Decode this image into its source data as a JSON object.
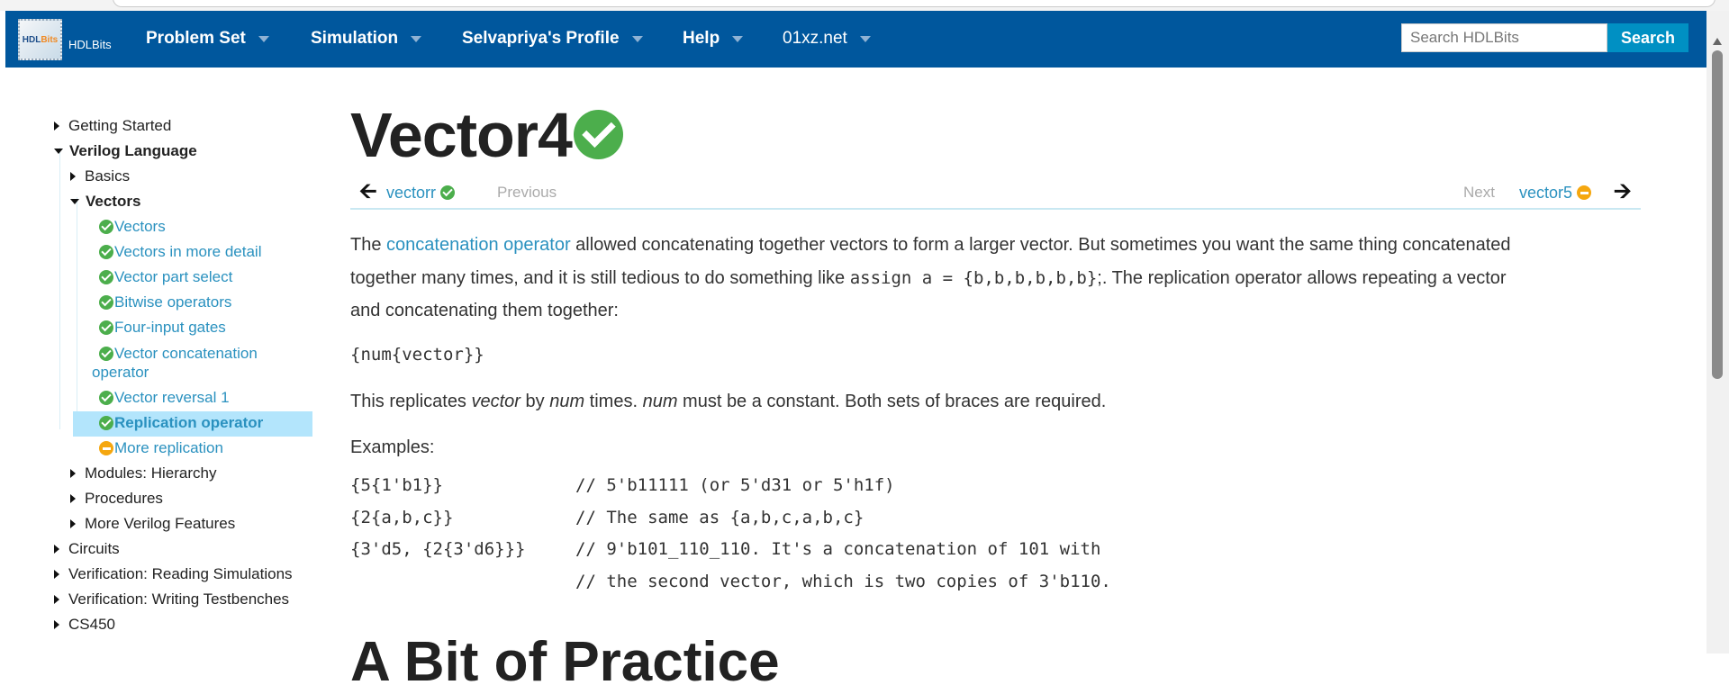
{
  "navbar": {
    "logo_text_a": "HDL",
    "logo_text_b": "Bits",
    "brand": "HDLBits",
    "menus": [
      {
        "label": "Problem Set"
      },
      {
        "label": "Simulation"
      },
      {
        "label": "Selvapriya's Profile"
      },
      {
        "label": "Help"
      },
      {
        "label": "01xz.net"
      }
    ],
    "search_placeholder": "Search HDLBits",
    "search_button": "Search",
    "color": "#00579d"
  },
  "sidebar": {
    "items": [
      {
        "label": "Getting Started"
      },
      {
        "label": "Verilog Language"
      },
      {
        "label": "Basics"
      },
      {
        "label": "Vectors"
      },
      {
        "label": "Vectors",
        "status": "done"
      },
      {
        "label": "Vectors in more detail",
        "status": "done"
      },
      {
        "label": "Vector part select",
        "status": "done"
      },
      {
        "label": "Bitwise operators",
        "status": "done"
      },
      {
        "label": "Four-input gates",
        "status": "done"
      },
      {
        "label": "Vector concatenation",
        "label2": "operator",
        "status": "done"
      },
      {
        "label": "Vector reversal 1",
        "status": "done"
      },
      {
        "label": "Replication operator",
        "status": "done",
        "active": true
      },
      {
        "label": "More replication",
        "status": "pending"
      },
      {
        "label": "Modules: Hierarchy"
      },
      {
        "label": "Procedures"
      },
      {
        "label": "More Verilog Features"
      },
      {
        "label": "Circuits"
      },
      {
        "label": "Verification: Reading Simulations"
      },
      {
        "label": "Verification: Writing Testbenches"
      },
      {
        "label": "CS450"
      }
    ]
  },
  "main": {
    "title": "Vector4",
    "title_status": "done",
    "prev": {
      "name": "vectorr",
      "label": "Previous",
      "status": "done"
    },
    "next": {
      "name": "vector5",
      "label": "Next",
      "status": "pending"
    },
    "para1": {
      "a": "The ",
      "link": "concatenation operator",
      "b": " allowed concatenating together vectors to form a larger vector. But sometimes you want the same thing concatenated",
      "c": "together many times, and it is still tedious to do something like ",
      "code": "assign a = {b,b,b,b,b,b}",
      "d": ";. The replication operator allows repeating a vector",
      "e": "and concatenating them together:"
    },
    "syntax": "{num{vector}}",
    "para2": {
      "a": "This replicates ",
      "b": "vector",
      "c": " by ",
      "d": "num",
      "e": " times. ",
      "f": "num",
      "g": " must be a constant. Both sets of braces are required."
    },
    "examples_label": "Examples:",
    "examples": [
      {
        "code": "{5{1'b1}}",
        "comment": "// 5'b11111 (or 5'd31 or 5'h1f)"
      },
      {
        "code": "{2{a,b,c}}",
        "comment": "// The same as {a,b,c,a,b,c}"
      },
      {
        "code": "{3'd5, {2{3'd6}}}",
        "comment": "// 9'b101_110_110. It's a concatenation of 101 with"
      },
      {
        "code": "",
        "comment": "// the second vector, which is two copies of 3'b110."
      }
    ],
    "section_heading": "A Bit of Practice"
  },
  "colors": {
    "link": "#2a91bf",
    "done": "#4cae4c",
    "pending": "#f5a70f",
    "active_bg": "#b3e5fc",
    "search_button": "#0090c3"
  }
}
